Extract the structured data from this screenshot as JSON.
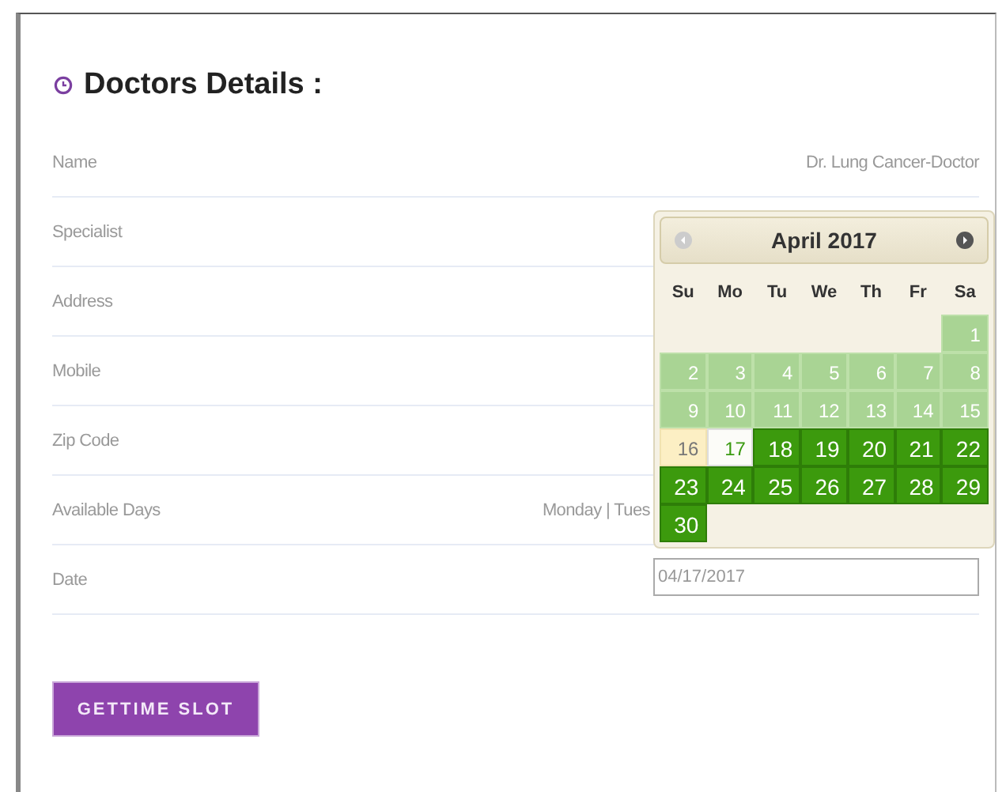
{
  "title": "Doctors Details :",
  "fields": [
    {
      "label": "Name",
      "value": "Dr. Lung Cancer-Doctor"
    },
    {
      "label": "Specialist"
    },
    {
      "label": "Address"
    },
    {
      "label": "Mobile"
    },
    {
      "label": "Zip Code"
    },
    {
      "label": "Available Days",
      "value": "Monday | Tues"
    },
    {
      "label": "Date",
      "input": "04/17/2017"
    }
  ],
  "calendar": {
    "month": "April 2017",
    "prev": {
      "disabled": true
    },
    "next": {
      "disabled": false
    },
    "weekdays": [
      "Su",
      "Mo",
      "Tu",
      "We",
      "Th",
      "Fr",
      "Sa"
    ],
    "weeks": [
      [
        {
          "day": "1",
          "kind": "past"
        }
      ],
      [
        {
          "day": "2",
          "kind": "past"
        },
        {
          "day": "3",
          "kind": "past"
        },
        {
          "day": "4",
          "kind": "past"
        },
        {
          "day": "5",
          "kind": "past"
        },
        {
          "day": "6",
          "kind": "past"
        },
        {
          "day": "7",
          "kind": "past"
        },
        {
          "day": "8",
          "kind": "past"
        }
      ],
      [
        {
          "day": "9",
          "kind": "past"
        },
        {
          "day": "10",
          "kind": "past"
        },
        {
          "day": "11",
          "kind": "past"
        },
        {
          "day": "12",
          "kind": "past"
        },
        {
          "day": "13",
          "kind": "past"
        },
        {
          "day": "14",
          "kind": "past"
        },
        {
          "day": "15",
          "kind": "past"
        }
      ],
      [
        {
          "day": "16",
          "kind": "today"
        },
        {
          "day": "17",
          "kind": "selected"
        },
        {
          "day": "18",
          "kind": "available"
        },
        {
          "day": "19",
          "kind": "available"
        },
        {
          "day": "20",
          "kind": "available"
        },
        {
          "day": "21",
          "kind": "available"
        },
        {
          "day": "22",
          "kind": "available"
        }
      ],
      [
        {
          "day": "23",
          "kind": "available"
        },
        {
          "day": "24",
          "kind": "available"
        },
        {
          "day": "25",
          "kind": "available"
        },
        {
          "day": "26",
          "kind": "available"
        },
        {
          "day": "27",
          "kind": "available"
        },
        {
          "day": "28",
          "kind": "available"
        },
        {
          "day": "29",
          "kind": "available"
        }
      ],
      [
        {
          "day": "30",
          "kind": "available"
        }
      ]
    ]
  },
  "button": "GETTIME SLOT"
}
